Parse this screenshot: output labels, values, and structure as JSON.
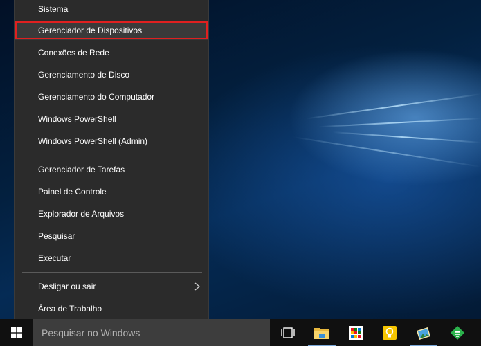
{
  "context_menu": {
    "items": [
      {
        "label": "Sistema"
      },
      {
        "label": "Gerenciador de Dispositivos",
        "highlighted": true
      },
      {
        "label": "Conexões de Rede"
      },
      {
        "label": "Gerenciamento de Disco"
      },
      {
        "label": "Gerenciamento do Computador"
      },
      {
        "label": "Windows PowerShell"
      },
      {
        "label": "Windows PowerShell (Admin)"
      },
      {
        "label": "Gerenciador de Tarefas"
      },
      {
        "label": "Painel de Controle"
      },
      {
        "label": "Explorador de Arquivos"
      },
      {
        "label": "Pesquisar"
      },
      {
        "label": "Executar"
      },
      {
        "label": "Desligar ou sair",
        "has_submenu": true
      },
      {
        "label": "Área de Trabalho"
      }
    ],
    "highlight_color": "#e02020"
  },
  "taskbar": {
    "search_placeholder": "Pesquisar no Windows",
    "icons": [
      {
        "name": "task-view-icon"
      },
      {
        "name": "file-explorer-icon"
      },
      {
        "name": "store-icon"
      },
      {
        "name": "tips-icon"
      },
      {
        "name": "photos-icon"
      },
      {
        "name": "feedly-icon"
      }
    ]
  }
}
